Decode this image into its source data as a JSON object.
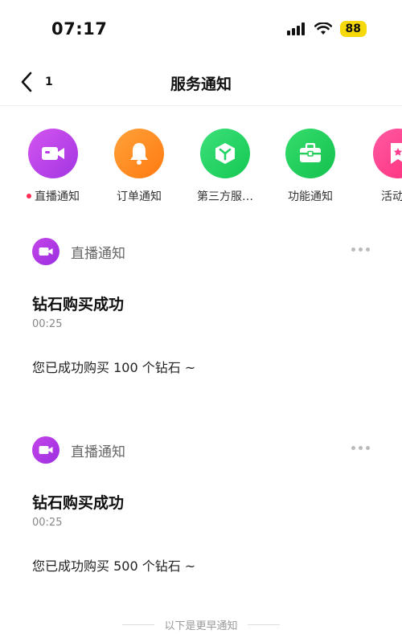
{
  "status_bar": {
    "time": "07:17",
    "battery": "88"
  },
  "nav": {
    "back_count": "1",
    "title": "服务通知"
  },
  "categories": [
    {
      "label": "直播通知",
      "icon": "live-camera-icon",
      "color": "#b93ee6",
      "unread": true
    },
    {
      "label": "订单通知",
      "icon": "bell-icon",
      "color": "#ff8a1e",
      "unread": false
    },
    {
      "label": "第三方服…",
      "icon": "cube-icon",
      "color": "#22d463",
      "unread": false
    },
    {
      "label": "功能通知",
      "icon": "toolbox-icon",
      "color": "#21cf5a",
      "unread": false
    },
    {
      "label": "活动通",
      "icon": "star-bookmark-icon",
      "color": "#ff3d8f",
      "unread": false
    }
  ],
  "cards": [
    {
      "source": "直播通知",
      "title": "钻石购买成功",
      "time": "00:25",
      "body": "您已成功购买 100 个钻石 ~"
    },
    {
      "source": "直播通知",
      "title": "钻石购买成功",
      "time": "00:25",
      "body": "您已成功购买 500 个钻石 ~"
    }
  ],
  "footer": {
    "earlier_text": "以下是更早通知"
  }
}
